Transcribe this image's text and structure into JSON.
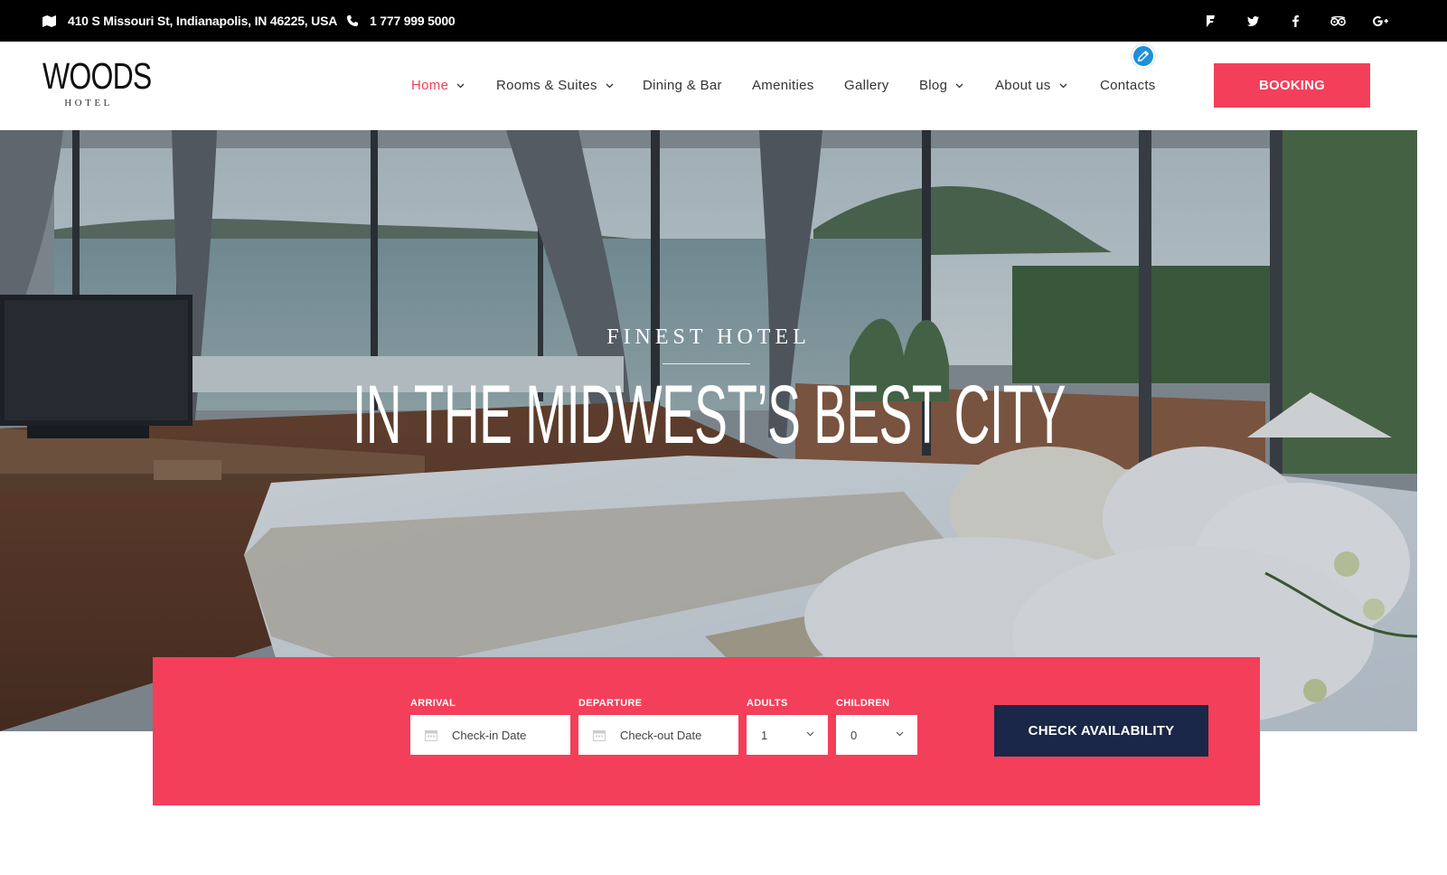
{
  "topbar": {
    "address": "410 S Missouri St, Indianapolis, IN 46225, USA",
    "phone": "1 777 999 5000",
    "social_icons": [
      "foursquare-icon",
      "twitter-icon",
      "facebook-icon",
      "tripadvisor-icon",
      "google-plus-icon"
    ]
  },
  "logo": {
    "name": "WOODS",
    "sub": "HOTEL"
  },
  "nav": {
    "items": [
      {
        "label": "Home",
        "dropdown": true,
        "active": true
      },
      {
        "label": "Rooms & Suites",
        "dropdown": true
      },
      {
        "label": "Dining & Bar",
        "dropdown": false
      },
      {
        "label": "Amenities",
        "dropdown": false
      },
      {
        "label": "Gallery",
        "dropdown": false
      },
      {
        "label": "Blog",
        "dropdown": true
      },
      {
        "label": "About us",
        "dropdown": true
      },
      {
        "label": "Contacts",
        "dropdown": false
      }
    ],
    "booking": "BOOKING"
  },
  "hero": {
    "kicker": "FINEST HOTEL",
    "headline": "IN THE MIDWEST’S BEST CITY"
  },
  "reservation": {
    "arrival_label": "ARRIVAL",
    "arrival_placeholder": "Check-in Date",
    "departure_label": "DEPARTURE",
    "departure_placeholder": "Check-out Date",
    "adults_label": "ADULTS",
    "adults_value": "1",
    "children_label": "CHILDREN",
    "children_value": "0",
    "submit": "CHECK AVAILABILITY"
  },
  "colors": {
    "accent": "#f33f5a",
    "dark": "#1a2748",
    "topbar": "#000000",
    "edit_badge": "#1e8fd8"
  }
}
